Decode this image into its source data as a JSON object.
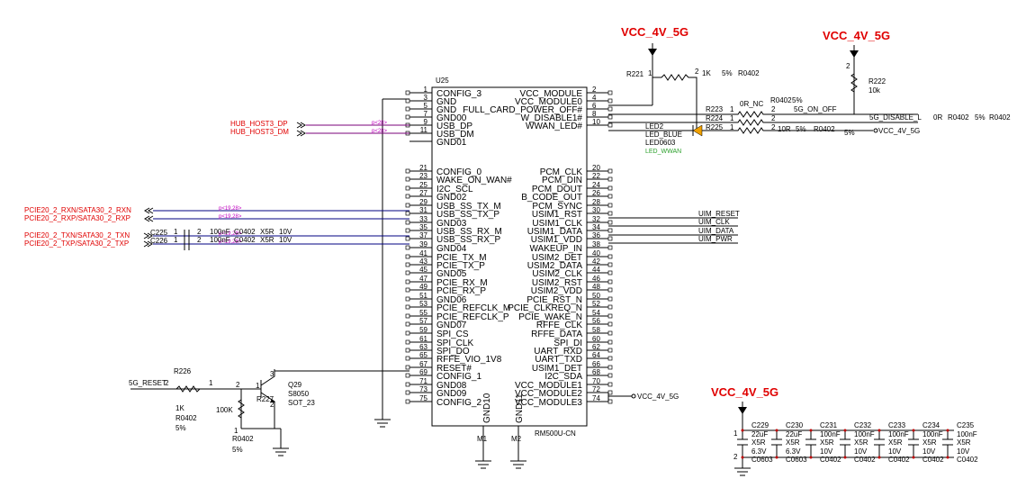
{
  "power": {
    "vcc_5g": "VCC_4V_5G",
    "vcc_4v_5g": "VCC_4V_5G"
  },
  "chip": {
    "ref": "U25",
    "part": "RM500U-CN",
    "bottom_pins": [
      {
        "num": "M1",
        "name": "GND10"
      },
      {
        "num": "M2",
        "name": "GND11"
      }
    ],
    "left_pins": [
      {
        "num": "1",
        "name": "CONFIG_3"
      },
      {
        "num": "3",
        "name": "GND"
      },
      {
        "num": "5",
        "name": "GND"
      },
      {
        "num": "7",
        "name": "GND00"
      },
      {
        "num": "9",
        "name": "USB_DP"
      },
      {
        "num": "11",
        "name": "USB_DM"
      },
      {
        "num": "",
        "name": "GND01"
      },
      {
        "num": "21",
        "name": "CONFIG_0"
      },
      {
        "num": "23",
        "name": "WAKE_ON_WAN#"
      },
      {
        "num": "25",
        "name": "I2C_SCL"
      },
      {
        "num": "27",
        "name": "GND02"
      },
      {
        "num": "29",
        "name": "USB_SS_TX_M"
      },
      {
        "num": "31",
        "name": "USB_SS_TX_P"
      },
      {
        "num": "33",
        "name": "GND03"
      },
      {
        "num": "35",
        "name": "USB_SS_RX_M"
      },
      {
        "num": "37",
        "name": "USB_SS_RX_P"
      },
      {
        "num": "39",
        "name": "GND04"
      },
      {
        "num": "41",
        "name": "PCIE_TX_M"
      },
      {
        "num": "43",
        "name": "PCIE_TX_P"
      },
      {
        "num": "45",
        "name": "GND05"
      },
      {
        "num": "47",
        "name": "PCIE_RX_M"
      },
      {
        "num": "49",
        "name": "PCIE_RX_P"
      },
      {
        "num": "51",
        "name": "GND06"
      },
      {
        "num": "53",
        "name": "PCIE_REFCLK_M"
      },
      {
        "num": "55",
        "name": "PCIE_REFCLK_P"
      },
      {
        "num": "57",
        "name": "GND07"
      },
      {
        "num": "59",
        "name": "SPI_CS"
      },
      {
        "num": "61",
        "name": "SPI_CLK"
      },
      {
        "num": "63",
        "name": "SPI_DO"
      },
      {
        "num": "65",
        "name": "RFFE_VIO_1V8"
      },
      {
        "num": "67",
        "name": "RESET#"
      },
      {
        "num": "69",
        "name": "CONFIG_1"
      },
      {
        "num": "71",
        "name": "GND08"
      },
      {
        "num": "73",
        "name": "GND09"
      },
      {
        "num": "75",
        "name": "CONFIG_2"
      }
    ],
    "right_pins": [
      {
        "num": "2",
        "name": "VCC_MODULE"
      },
      {
        "num": "4",
        "name": "VCC_MODULE0"
      },
      {
        "num": "6",
        "name": "FULL_CARD_POWER_OFF#"
      },
      {
        "num": "8",
        "name": "W_DISABLE1#"
      },
      {
        "num": "10",
        "name": "WWAN_LED#"
      },
      {
        "num": "20",
        "name": "PCM_CLK"
      },
      {
        "num": "22",
        "name": "PCM_DIN"
      },
      {
        "num": "24",
        "name": "PCM_DOUT"
      },
      {
        "num": "26",
        "name": "B_CODE_OUT"
      },
      {
        "num": "28",
        "name": "PCM_SYNC"
      },
      {
        "num": "30",
        "name": "USIM1_RST"
      },
      {
        "num": "32",
        "name": "USIM1_CLK"
      },
      {
        "num": "34",
        "name": "USIM1_DATA"
      },
      {
        "num": "36",
        "name": "USIM1_VDD"
      },
      {
        "num": "38",
        "name": "WAKEUP_IN"
      },
      {
        "num": "40",
        "name": "USIM2_DET"
      },
      {
        "num": "42",
        "name": "USIM2_DATA"
      },
      {
        "num": "44",
        "name": "USIM2_CLK"
      },
      {
        "num": "46",
        "name": "USIM2_RST"
      },
      {
        "num": "48",
        "name": "USIM2_VDD"
      },
      {
        "num": "50",
        "name": "PCIE_RST_N"
      },
      {
        "num": "52",
        "name": "PCIE_CLKREQ_N"
      },
      {
        "num": "54",
        "name": "PCIE_WAKE_N"
      },
      {
        "num": "56",
        "name": "RFFE_CLK"
      },
      {
        "num": "58",
        "name": "RFFE_DATA"
      },
      {
        "num": "60",
        "name": "SPI_DI"
      },
      {
        "num": "62",
        "name": "UART_RXD"
      },
      {
        "num": "64",
        "name": "UART_TXD"
      },
      {
        "num": "66",
        "name": "USIM1_DET"
      },
      {
        "num": "68",
        "name": "I2C_SDA"
      },
      {
        "num": "70",
        "name": "VCC_MODULE1"
      },
      {
        "num": "72",
        "name": "VCC_MODULE2"
      },
      {
        "num": "74",
        "name": "VCC_MODULE3"
      }
    ]
  },
  "nets": {
    "hub_dp": "HUB_HOST3_DP",
    "hub_dm": "HUB_HOST3_DM",
    "rxn": "PCIE20_2_RXN/SATA30_2_RXN",
    "rxp": "PCIE20_2_RXP/SATA30_2_RXP",
    "txn": "PCIE20_2_TXN/SATA30_2_TXN",
    "txp": "PCIE20_2_TXP/SATA30_2_TXP",
    "uim_reset": "UIM_RESET",
    "uim_clk": "UIM_CLK",
    "uim_data": "UIM_DATA",
    "uim_pwr": "UIM_PWR",
    "on_off": "5G_ON_OFF",
    "disable": "5G_DISABLE_L",
    "vcc_net": "VCC_4V_5G",
    "reset": "5G_RESET",
    "ovl_p1": "p<28>",
    "ovl_p2": "p<28>",
    "ovl_p3": "p<19,28>",
    "ovl_p4": "p<19,28>",
    "ovl_p5": "p<19,28>",
    "ovl_p6": "p<19,28>"
  },
  "parts": {
    "r221": {
      "ref": "R221",
      "p1": "1",
      "p2": "2",
      "val": "1K",
      "tol": "5%",
      "pkg": "R0402"
    },
    "r222": {
      "ref": "R222",
      "val": "10k",
      "p2": "2"
    },
    "r223": {
      "ref": "R223",
      "val": "0R_NC",
      "p1": "1",
      "p2": "2",
      "pkg": "R0402",
      "tol": "5%"
    },
    "r224": {
      "ref": "R224",
      "p1": "1",
      "p2": "2",
      "val": "0R",
      "pkg": "R0402",
      "tol": "5%"
    },
    "r225": {
      "ref": "R225",
      "p1": "1",
      "p2": "2",
      "val": "10R",
      "tol": "5%",
      "pkg": "R0402"
    },
    "led": {
      "ref": "LED2",
      "val": "LED_BLUE",
      "pkg": "LED0603",
      "desc": "LED_WWAN"
    },
    "c225": {
      "ref": "C225",
      "val": "100nF",
      "pkg": "C0402",
      "die": "X5R",
      "volt": "10V",
      "p1": "1",
      "p2": "2"
    },
    "c226": {
      "ref": "C226",
      "val": "100nF",
      "pkg": "C0402",
      "die": "X5R",
      "volt": "10V",
      "p1": "1",
      "p2": "2"
    },
    "r226": {
      "ref": "R226",
      "p1": "1",
      "p2": "2",
      "val": "1K",
      "pkg": "R0402",
      "tol": "5%"
    },
    "r227": {
      "ref": "R227",
      "val": "100K",
      "pkg": "R0402",
      "tol": "5%",
      "p1": "1",
      "p2": "2"
    },
    "q29": {
      "ref": "Q29",
      "val": "S8050",
      "pkg": "SOT_23",
      "p1": "1",
      "p2": "2",
      "p3": "3"
    },
    "caps": [
      {
        "ref": "C229",
        "val": "22uF",
        "die": "X5R",
        "volt": "6.3V",
        "pkg": "C0603"
      },
      {
        "ref": "C230",
        "val": "22uF",
        "die": "X5R",
        "volt": "6.3V",
        "pkg": "C0603"
      },
      {
        "ref": "C231",
        "val": "100nF",
        "die": "X5R",
        "volt": "10V",
        "pkg": "C0402"
      },
      {
        "ref": "C232",
        "val": "100nF",
        "die": "X5R",
        "volt": "10V",
        "pkg": "C0402"
      },
      {
        "ref": "C233",
        "val": "100nF",
        "die": "X5R",
        "volt": "10V",
        "pkg": "C0402"
      },
      {
        "ref": "C234",
        "val": "100nF",
        "die": "X5R",
        "volt": "10V",
        "pkg": "C0402"
      },
      {
        "ref": "C235",
        "val": "100nF",
        "die": "X5R",
        "volt": "10V",
        "pkg": "C0402"
      }
    ],
    "cap_p1": "1",
    "cap_p2": "2"
  }
}
